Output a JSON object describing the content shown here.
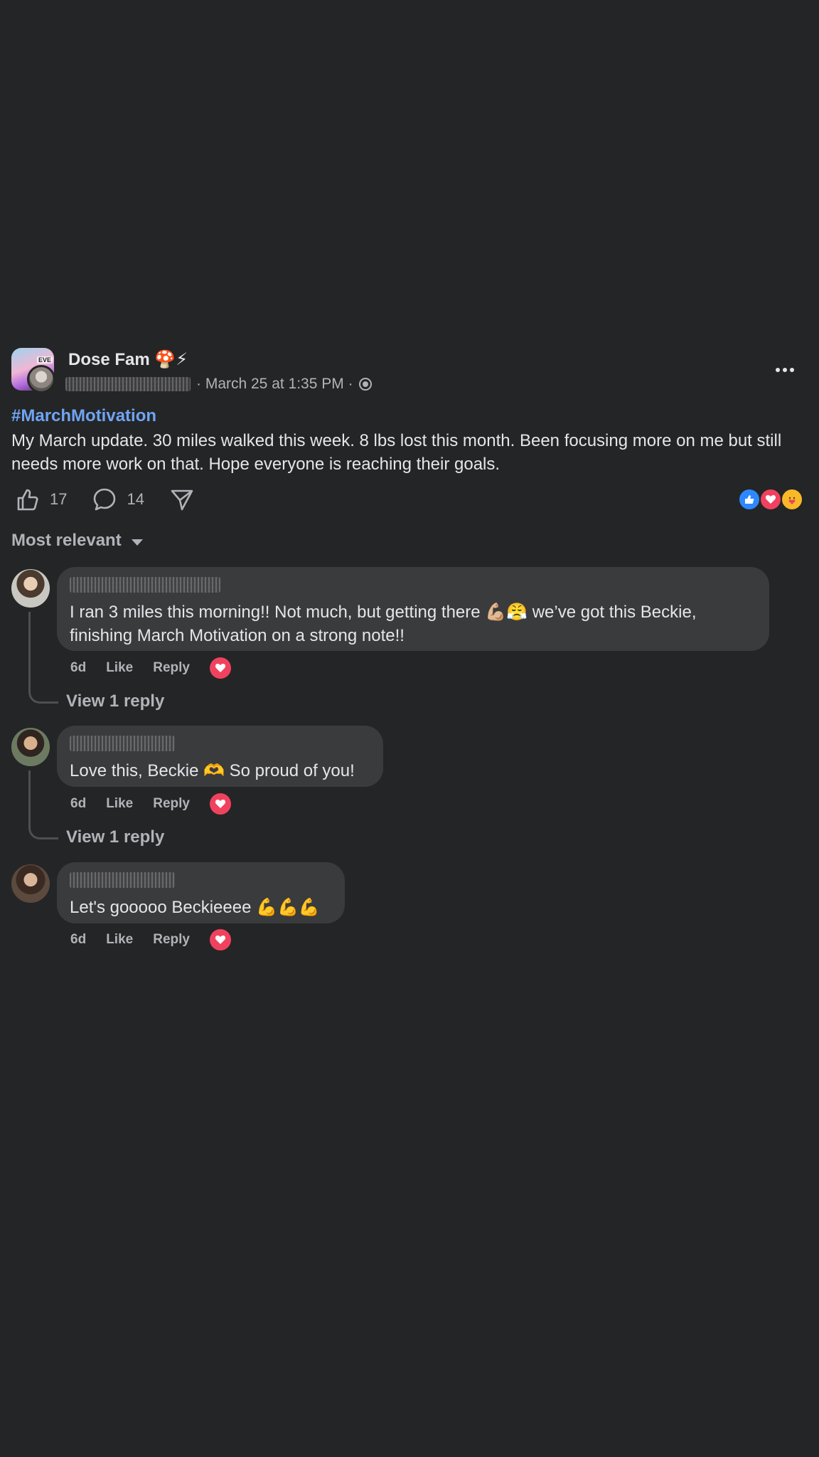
{
  "post": {
    "group_name": "Dose Fam 🍄⚡",
    "avatar_tag": "EVE",
    "timestamp": "· March 25 at 1:35 PM ·",
    "hashtag": "#MarchMotivation",
    "text": "My March update. 30 miles walked this week. 8 lbs lost this month. Been focusing more on me but still needs more work on that. Hope everyone is reaching their goals.",
    "like_count": "17",
    "comment_count": "14",
    "reactions": [
      "like",
      "love",
      "care"
    ]
  },
  "sort": {
    "label": "Most relevant"
  },
  "comments": [
    {
      "text": "I ran 3 miles this morning!! Not much, but getting there 💪🏼😤 we’ve got this Beckie, finishing March Motivation on a strong note!!",
      "time": "6d",
      "like_label": "Like",
      "reply_label": "Reply",
      "view_replies": "View 1 reply"
    },
    {
      "text": "Love this, Beckie 🫶 So proud of you!",
      "time": "6d",
      "like_label": "Like",
      "reply_label": "Reply",
      "view_replies": "View 1 reply"
    },
    {
      "text": "Let's gooooo Beckieeee 💪💪💪",
      "time": "6d",
      "like_label": "Like",
      "reply_label": "Reply"
    }
  ],
  "colors": {
    "background": "#242526",
    "bubble": "#3a3b3c",
    "hashtag": "#6fa4f2",
    "love": "#f0425f",
    "like": "#2d88ff"
  }
}
